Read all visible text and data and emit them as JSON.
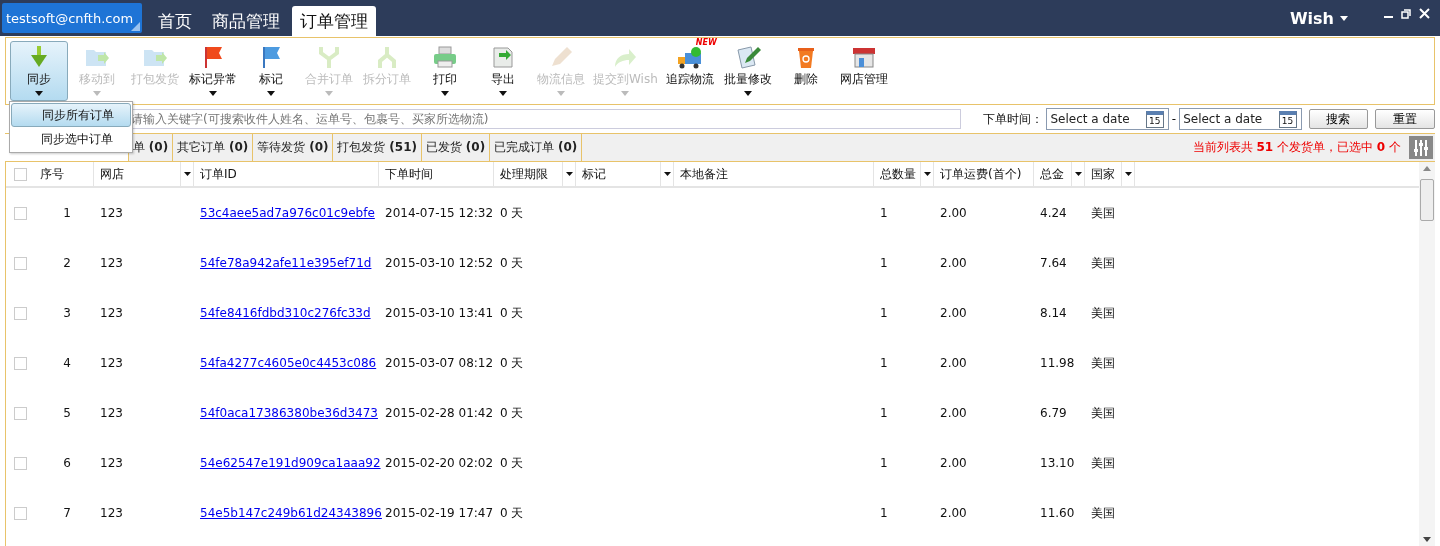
{
  "account": "testsoft@cnfth.com",
  "nav_tabs": [
    {
      "label": "首页",
      "selected": false
    },
    {
      "label": "商品管理",
      "selected": false
    },
    {
      "label": "订单管理",
      "selected": true
    }
  ],
  "platform": "Wish",
  "toolbar": [
    {
      "kind": "sync",
      "label": "同步",
      "disabled": false,
      "dropdown": true,
      "pressed": true
    },
    {
      "kind": "move",
      "label": "移动到",
      "disabled": true,
      "dropdown": true,
      "pressed": false
    },
    {
      "kind": "pack",
      "label": "打包发货",
      "disabled": true,
      "dropdown": false,
      "pressed": false
    },
    {
      "kind": "redflag",
      "label": "标记异常",
      "disabled": false,
      "dropdown": true,
      "pressed": false
    },
    {
      "kind": "blueflag",
      "label": "标记",
      "disabled": false,
      "dropdown": true,
      "pressed": false
    },
    {
      "kind": "merge",
      "label": "合并订单",
      "disabled": true,
      "dropdown": true,
      "pressed": false
    },
    {
      "kind": "split",
      "label": "拆分订单",
      "disabled": true,
      "dropdown": false,
      "pressed": false
    },
    {
      "kind": "print",
      "label": "打印",
      "disabled": false,
      "dropdown": true,
      "pressed": false
    },
    {
      "kind": "export",
      "label": "导出",
      "disabled": false,
      "dropdown": true,
      "pressed": false
    },
    {
      "kind": "pencil",
      "label": "物流信息",
      "disabled": true,
      "dropdown": true,
      "pressed": false
    },
    {
      "kind": "submit",
      "label": "提交到Wish",
      "disabled": true,
      "dropdown": true,
      "pressed": false
    },
    {
      "kind": "truck",
      "label": "追踪物流",
      "disabled": false,
      "dropdown": false,
      "pressed": false,
      "badge": "NEW"
    },
    {
      "kind": "edit",
      "label": "批量修改",
      "disabled": false,
      "dropdown": true,
      "pressed": false
    },
    {
      "kind": "trash",
      "label": "删除",
      "disabled": false,
      "dropdown": false,
      "pressed": false
    },
    {
      "kind": "shop",
      "label": "网店管理",
      "disabled": false,
      "dropdown": false,
      "pressed": false
    }
  ],
  "sync_menu": [
    {
      "label": "同步所有订单",
      "selected": true
    },
    {
      "label": "同步选中订单",
      "selected": false
    }
  ],
  "search": {
    "placeholder": "请输入关键字(可搜索收件人姓名、运单号、包裹号、买家所选物流)"
  },
  "date_filter": {
    "label": "下单时间：",
    "from_placeholder": "Select a date",
    "to_placeholder": "Select a date",
    "separator": "-",
    "from_calendar_day": "15",
    "to_calendar_day": "15"
  },
  "buttons": [
    "搜索",
    "重置"
  ],
  "status_tabs": [
    {
      "label": "单",
      "count": "(0)",
      "selected": false
    },
    {
      "label": "其它订单",
      "count": "(0)",
      "selected": false
    },
    {
      "label": "等待发货",
      "count": "(0)",
      "selected": false
    },
    {
      "label": "打包发货",
      "count": "(51)",
      "selected": false
    },
    {
      "label": "已发货",
      "count": "(0)",
      "selected": false
    },
    {
      "label": "已完成订单",
      "count": "(0)",
      "selected": false
    }
  ],
  "summary": "当前列表共 **51** 个发货单，已选中 **0** 个",
  "table": {
    "select_all_checked": false,
    "columns": [
      {
        "label": "序号",
        "filter": false
      },
      {
        "label": "网店",
        "filter": true
      },
      {
        "label": "订单ID",
        "filter": false
      },
      {
        "label": "下单时间",
        "filter": false
      },
      {
        "label": "处理期限",
        "filter": true
      },
      {
        "label": "标记",
        "filter": true
      },
      {
        "label": "本地备注",
        "filter": false
      },
      {
        "label": "总数量",
        "filter": true
      },
      {
        "label": "订单运费(首个)",
        "filter": false
      },
      {
        "label": "总金",
        "filter": true
      },
      {
        "label": "国家",
        "filter": true
      }
    ],
    "rows": [
      {
        "checked": false,
        "cells": [
          "1",
          "123",
          "53c4aee5ad7a976c01c9ebfe",
          "2014-07-15 12:32",
          "0 天",
          "",
          "",
          "1",
          "2.00",
          "4.24",
          "美国"
        ]
      },
      {
        "checked": false,
        "cells": [
          "2",
          "123",
          "54fe78a942afe11e395ef71d",
          "2015-03-10 12:52",
          "0 天",
          "",
          "",
          "1",
          "2.00",
          "7.64",
          "美国"
        ]
      },
      {
        "checked": false,
        "cells": [
          "3",
          "123",
          "54fe8416fdbd310c276fc33d",
          "2015-03-10 13:41",
          "0 天",
          "",
          "",
          "1",
          "2.00",
          "8.14",
          "美国"
        ]
      },
      {
        "checked": false,
        "cells": [
          "4",
          "123",
          "54fa4277c4605e0c4453c086",
          "2015-03-07 08:12",
          "0 天",
          "",
          "",
          "1",
          "2.00",
          "11.98",
          "美国"
        ]
      },
      {
        "checked": false,
        "cells": [
          "5",
          "123",
          "54f0aca17386380be36d3473",
          "2015-02-28 01:42",
          "0 天",
          "",
          "",
          "1",
          "2.00",
          "6.79",
          "美国"
        ]
      },
      {
        "checked": false,
        "cells": [
          "6",
          "123",
          "54e62547e191d909ca1aaa92",
          "2015-02-20 02:02",
          "0 天",
          "",
          "",
          "1",
          "2.00",
          "13.10",
          "美国"
        ]
      },
      {
        "checked": false,
        "cells": [
          "7",
          "123",
          "54e5b147c249b61d24343896",
          "2015-02-19 17:47",
          "0 天",
          "",
          "",
          "1",
          "2.00",
          "11.60",
          "美国"
        ]
      }
    ]
  }
}
